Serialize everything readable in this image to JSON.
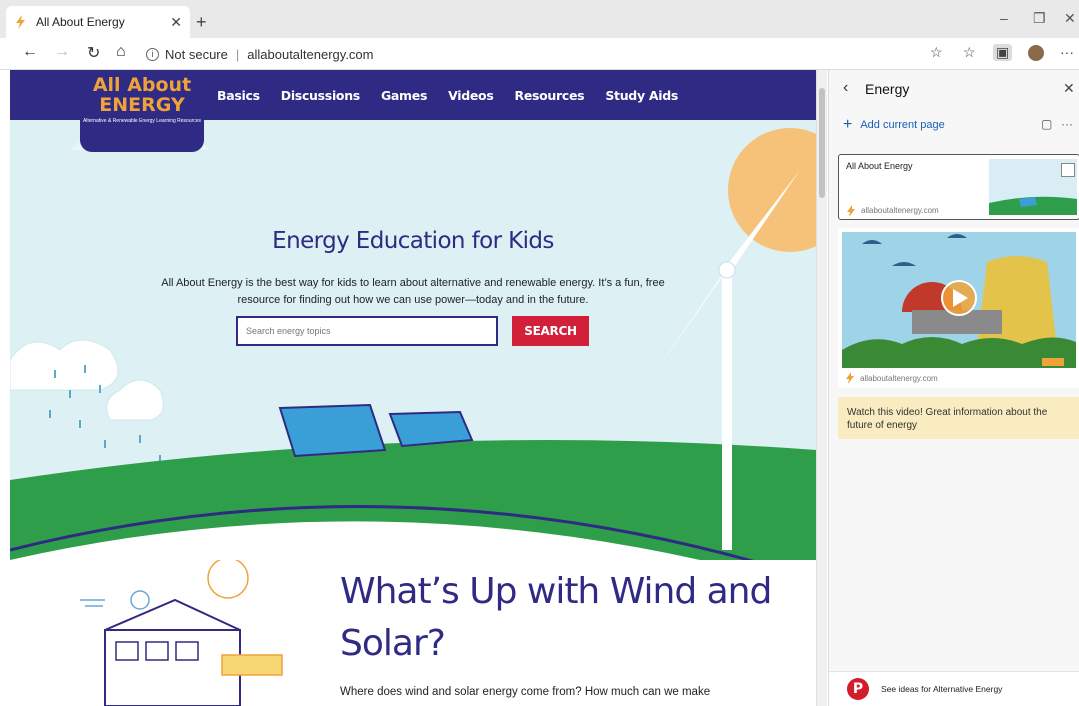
{
  "browser": {
    "tab_title": "All About Energy",
    "address_security": "Not secure",
    "address_url": "allaboutaltenergy.com",
    "window_controls": {
      "minimize": "–",
      "restore": "❐",
      "close": "✕"
    }
  },
  "site": {
    "logo_line1": "All About",
    "logo_line2": "ENERGY",
    "logo_tagline": "Alternative & Renewable Energy Learning Resources",
    "nav": [
      "Basics",
      "Discussions",
      "Games",
      "Videos",
      "Resources",
      "Study Aids"
    ],
    "hero_title": "Energy Education for Kids",
    "hero_text": "All About Energy is the best way for kids to learn about alternative and renewable energy. It’s a fun, free resource for finding out how we can use power—today and in the future.",
    "search_placeholder": "Search energy topics",
    "search_button": "SEARCH",
    "section_title": "What’s Up with Wind and Solar?",
    "section_text": "Where does wind and solar energy come from? How much can we make"
  },
  "collections": {
    "title": "Energy",
    "add_current_page": "Add current page",
    "card1": {
      "title": "All About Energy",
      "url": "allaboutaltenergy.com"
    },
    "card2": {
      "url": "allaboutaltenergy.com",
      "badge": "WATCH"
    },
    "note": "Watch this video! Great information about the future of energy",
    "footer": "See ideas for Alternative Energy"
  },
  "colors": {
    "nav_bg": "#2f2a84",
    "accent_red": "#d2203a",
    "logo_orange": "#f0a23a",
    "sky": "#ddf0f4",
    "grass": "#2e9e4a",
    "note_bg": "#f8ecc0"
  }
}
